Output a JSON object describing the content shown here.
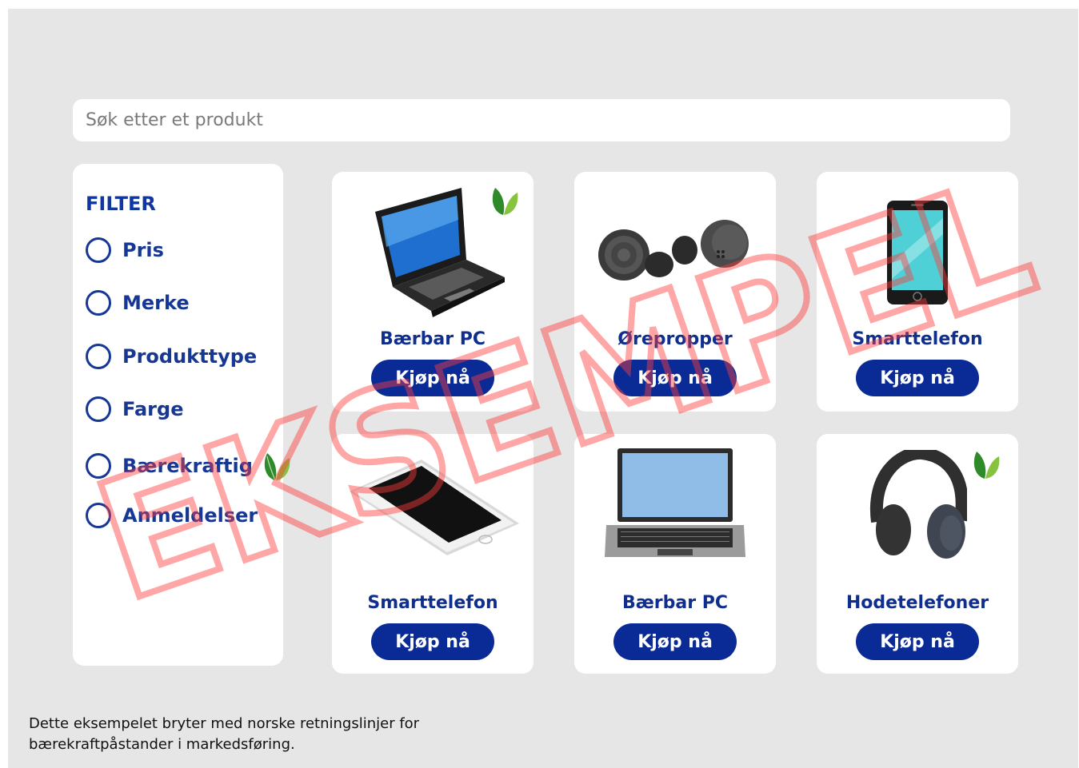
{
  "search": {
    "placeholder": "Søk etter et produkt",
    "value": ""
  },
  "filter": {
    "title": "FILTER",
    "options": [
      {
        "label": "Pris"
      },
      {
        "label": "Merke"
      },
      {
        "label": "Produkttype"
      },
      {
        "label": "Farge"
      },
      {
        "label": "Bærekraftig",
        "icon": "leaf-icon"
      },
      {
        "label": "Anmeldelser"
      }
    ]
  },
  "products": [
    {
      "name": "Bærbar PC",
      "button": "Kjøp nå",
      "image": "laptop-icon",
      "eco": true
    },
    {
      "name": "Ørepropper",
      "button": "Kjøp nå",
      "image": "earbuds-icon",
      "eco": false
    },
    {
      "name": "Smarttelefon",
      "button": "Kjøp nå",
      "image": "smartphone-icon",
      "eco": false
    },
    {
      "name": "Smarttelefon",
      "button": "Kjøp nå",
      "image": "smartphone-icon",
      "eco": false
    },
    {
      "name": "Bærbar PC",
      "button": "Kjøp nå",
      "image": "laptop-icon",
      "eco": false
    },
    {
      "name": "Hodetelefoner",
      "button": "Kjøp nå",
      "image": "headphones-icon",
      "eco": true
    }
  ],
  "footer": {
    "line1": "Dette eksempelet bryter med norske retningslinjer for",
    "line2": "bærekraftpåstander i markedsføring."
  },
  "watermark": {
    "text": "EKSEMPEL"
  },
  "colors": {
    "brand": "#0a2b96",
    "text_blue": "#173794",
    "background": "#e6e6e6",
    "leaf": "#6ab04c",
    "watermark": "#ff3b3b"
  }
}
